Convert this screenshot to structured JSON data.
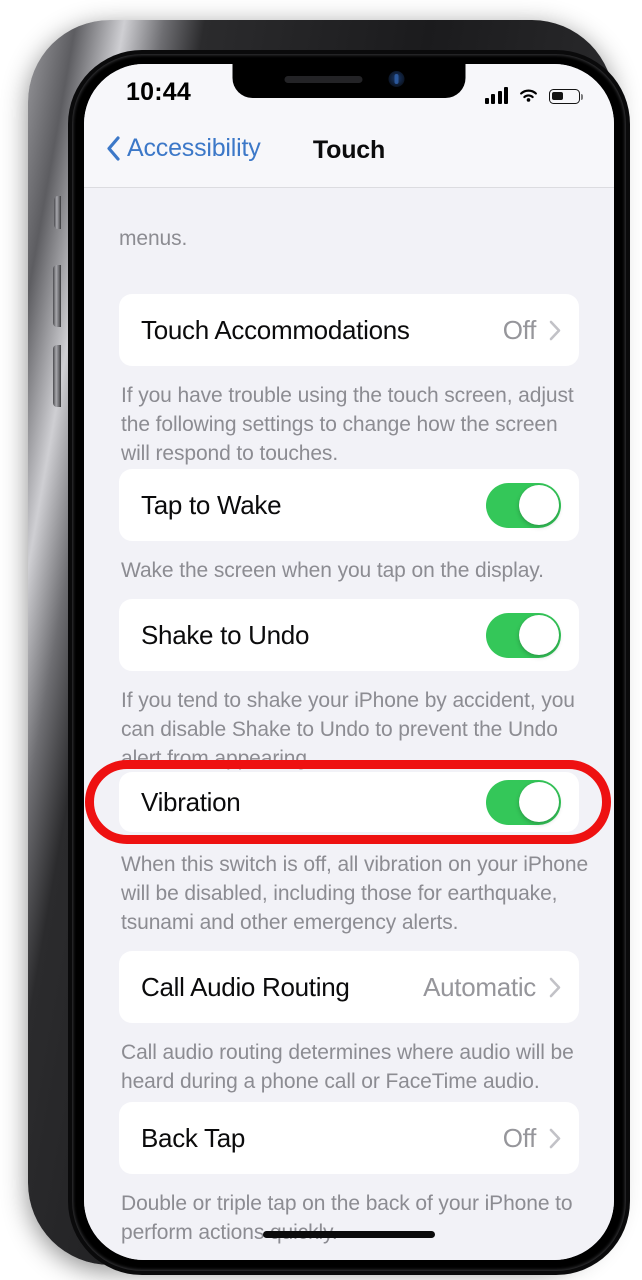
{
  "status_bar": {
    "time": "10:44",
    "cellular_icon": "cellular-bars-icon",
    "wifi_icon": "wifi-icon",
    "battery_icon": "battery-icon",
    "battery_level_percent": 40
  },
  "nav_bar": {
    "back_label": "Accessibility",
    "back_icon": "chevron-left-icon",
    "title": "Touch"
  },
  "content": {
    "orphan_footnote": "menus.",
    "rows": [
      {
        "label": "Touch Accommodations",
        "value": "Off",
        "type": "disclosure",
        "icon": "chevron-right-icon"
      },
      {
        "label": "Tap to Wake",
        "type": "toggle",
        "toggle_on": true
      },
      {
        "label": "Shake to Undo",
        "type": "toggle",
        "toggle_on": true
      },
      {
        "label": "Vibration",
        "type": "toggle",
        "toggle_on": true,
        "highlighted": true
      },
      {
        "label": "Call Audio Routing",
        "value": "Automatic",
        "type": "disclosure",
        "icon": "chevron-right-icon"
      },
      {
        "label": "Back Tap",
        "value": "Off",
        "type": "disclosure",
        "icon": "chevron-right-icon"
      }
    ],
    "footnotes": {
      "touch_accommodations": "If you have trouble using the touch screen, adjust the following settings to change how the screen will respond to touches.",
      "tap_to_wake": "Wake the screen when you tap on the display.",
      "shake_to_undo": "If you tend to shake your iPhone by accident, you can disable Shake to Undo to prevent the Undo alert from appearing.",
      "vibration": "When this switch is off, all vibration on your iPhone will be disabled, including those for earthquake, tsunami and other emergency alerts.",
      "call_audio_routing": "Call audio routing determines where audio will be heard during a phone call or FaceTime audio.",
      "back_tap": "Double or triple tap on the back of your iPhone to perform actions quickly."
    }
  },
  "annotation": {
    "shape": "oval-highlight",
    "color": "#EE1111",
    "targets_row": "Vibration"
  },
  "colors": {
    "toggle_on": "#34C759",
    "tint_blue": "#3C78C8",
    "group_background": "#F2F2F7",
    "card_background": "#FFFFFF",
    "secondary_text": "#8C8C92"
  },
  "home_indicator": "home-indicator"
}
